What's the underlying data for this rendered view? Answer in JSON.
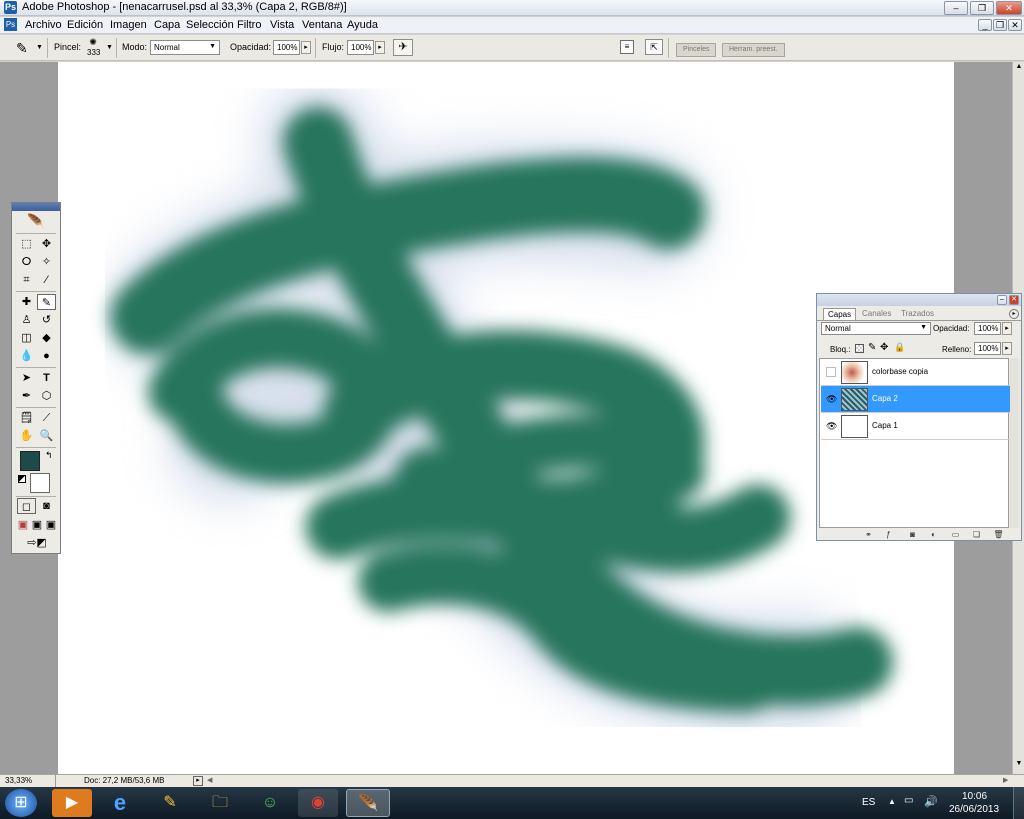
{
  "window": {
    "title": "Adobe Photoshop - [nenacarrusel.psd al 33,3% (Capa 2, RGB/8#)]",
    "app_icon": "photoshop-icon",
    "controls": [
      "minimize-icon",
      "restore-icon",
      "close-icon"
    ]
  },
  "menu": {
    "items": [
      "Archivo",
      "Edición",
      "Imagen",
      "Capa",
      "Selección",
      "Filtro",
      "Vista",
      "Ventana",
      "Ayuda"
    ]
  },
  "options": {
    "brush_label": "Pincel:",
    "brush_size": "333",
    "mode_label": "Modo:",
    "mode_value": "Normal",
    "opacity_label": "Opacidad:",
    "opacity_value": "100%",
    "flow_label": "Flujo:",
    "flow_value": "100%",
    "well_tabs": [
      "Pinceles",
      "Herram. preest."
    ]
  },
  "status": {
    "zoom": "33,33%",
    "doc": "Doc: 27,2 MB/53,6 MB"
  },
  "layers_panel": {
    "tabs": [
      "Capas",
      "Canales",
      "Trazados"
    ],
    "blend_mode": "Normal",
    "opacity_label": "Opacidad:",
    "opacity_value": "100%",
    "lock_label": "Bloq.:",
    "fill_label": "Relleno:",
    "fill_value": "100%",
    "layers": [
      {
        "name": "colorbase copia",
        "visible": false,
        "selected": false
      },
      {
        "name": "Capa 2",
        "visible": true,
        "selected": true
      },
      {
        "name": "Capa 1",
        "visible": true,
        "selected": false
      }
    ]
  },
  "taskbar": {
    "apps": [
      "start-orb-icon",
      "media-player-icon",
      "internet-explorer-icon",
      "paint-icon",
      "explorer-folder-icon",
      "messenger-icon",
      "chrome-icon",
      "photoshop-taskbar-icon"
    ],
    "lang": "ES",
    "time": "10:06",
    "date": "26/06/2013"
  },
  "colors": {
    "foreground": "#1f4a4a",
    "background": "#ffffff",
    "selection": "#3399ff",
    "halftone_dark": "#1c3a52",
    "halftone_green": "#3bd26a"
  }
}
